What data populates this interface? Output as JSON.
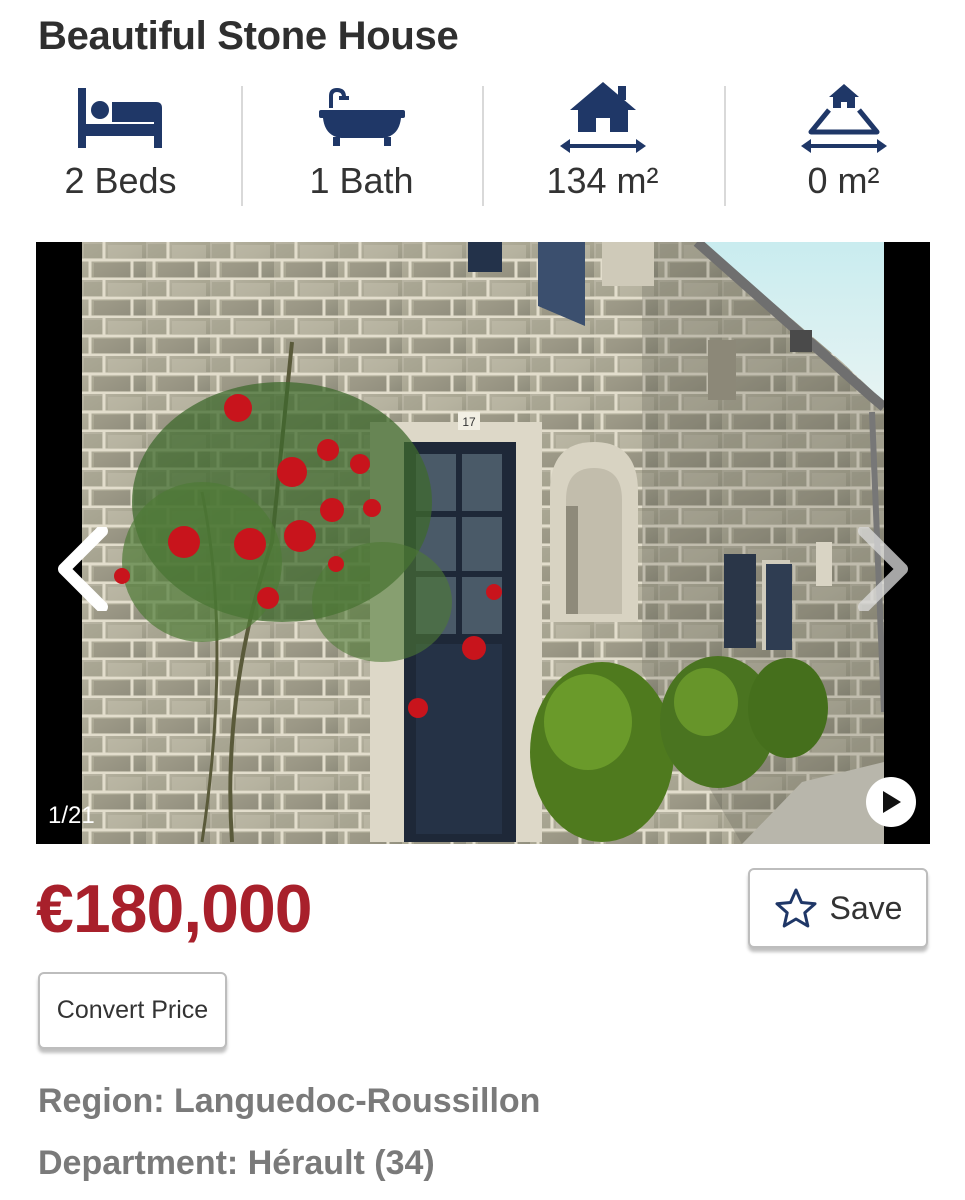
{
  "listing": {
    "title": "Beautiful Stone House",
    "features": [
      {
        "icon": "bed-icon",
        "label": "2 Beds"
      },
      {
        "icon": "bath-icon",
        "label": "1 Bath"
      },
      {
        "icon": "house-area-icon",
        "label": "134 m²"
      },
      {
        "icon": "land-area-icon",
        "label": "0 m²"
      }
    ],
    "gallery": {
      "counter": "1/21",
      "number_plate": "17"
    },
    "price": "€180,000",
    "save_label": "Save",
    "convert_label": "Convert Price",
    "region_text": "Region: Languedoc-Roussillon",
    "department_text": "Department: Hérault (34)"
  },
  "colors": {
    "icon_navy": "#1f3767",
    "price_red": "#a8202b",
    "info_gray": "#7a7a7a"
  }
}
